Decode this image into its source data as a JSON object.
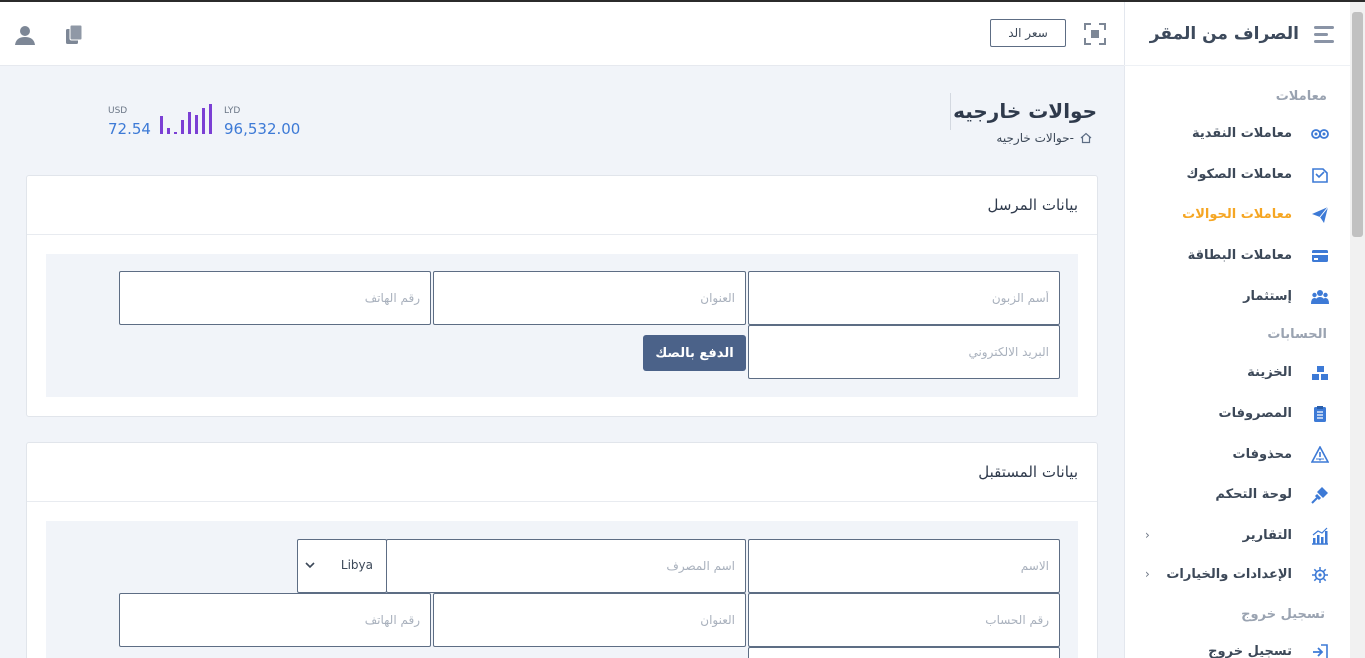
{
  "app": {
    "title": "الصراف من المقر"
  },
  "header": {
    "rate_button": "سعر الد"
  },
  "sidebar": {
    "section_transactions": "معاملات",
    "items": [
      {
        "label": "معاملات النقدية",
        "icon": "cash-exchange-icon"
      },
      {
        "label": "معاملات الصكوك",
        "icon": "cheque-icon"
      },
      {
        "label": "معاملات الحوالات",
        "icon": "paper-plane-icon",
        "active": true
      },
      {
        "label": "معاملات البطاقة",
        "icon": "credit-card-icon"
      },
      {
        "label": "إستثمار",
        "icon": "group-icon"
      }
    ],
    "section_accounts": "الحسابات",
    "account_items": [
      {
        "label": "الخزينة",
        "icon": "treasury-icon"
      },
      {
        "label": "المصروفات",
        "icon": "clipboard-icon"
      },
      {
        "label": "محذوفات",
        "icon": "warning-icon"
      },
      {
        "label": "لوحة التحكم",
        "icon": "plug-icon"
      },
      {
        "label": "التقارير",
        "icon": "bar-chart-icon"
      },
      {
        "label": "الإعدادات والخيارات",
        "icon": "settings-icon"
      }
    ],
    "section_logout": "تسجيل خروج",
    "logout_item": {
      "label": "تسجيل خروج",
      "icon": "logout-icon"
    }
  },
  "page": {
    "title": "حوالات خارجيه",
    "breadcrumb": "-حوالات خارجيه"
  },
  "stats": {
    "usd_label": "USD",
    "usd_value": "72.54",
    "lyd_label": "LYD",
    "lyd_value": "96,532.00",
    "bars": [
      0.55,
      0.2,
      0.05,
      0.45,
      0.7,
      0.6,
      0.8,
      0.95
    ]
  },
  "sender": {
    "title": "بيانات المرسل",
    "customer_name_placeholder": "أسم الزبون",
    "address_placeholder": "العنوان",
    "phone_placeholder": "رقم الهاتف",
    "email_placeholder": "البريد الالكتروني",
    "pay_button": "الدفع بالصك"
  },
  "receiver": {
    "title": "بيانات المستقبل",
    "name_placeholder": "الاسم",
    "bank_placeholder": "اسم المصرف",
    "country_value": "Libya",
    "account_placeholder": "رقم الحساب",
    "address_placeholder": "العنوان",
    "phone_placeholder": "رقم الهاتف"
  },
  "colors": {
    "accent": "#f5a623",
    "primary_button": "#4b6289",
    "stat_value": "#3d7ad6",
    "bars": "#7b3fd4"
  }
}
